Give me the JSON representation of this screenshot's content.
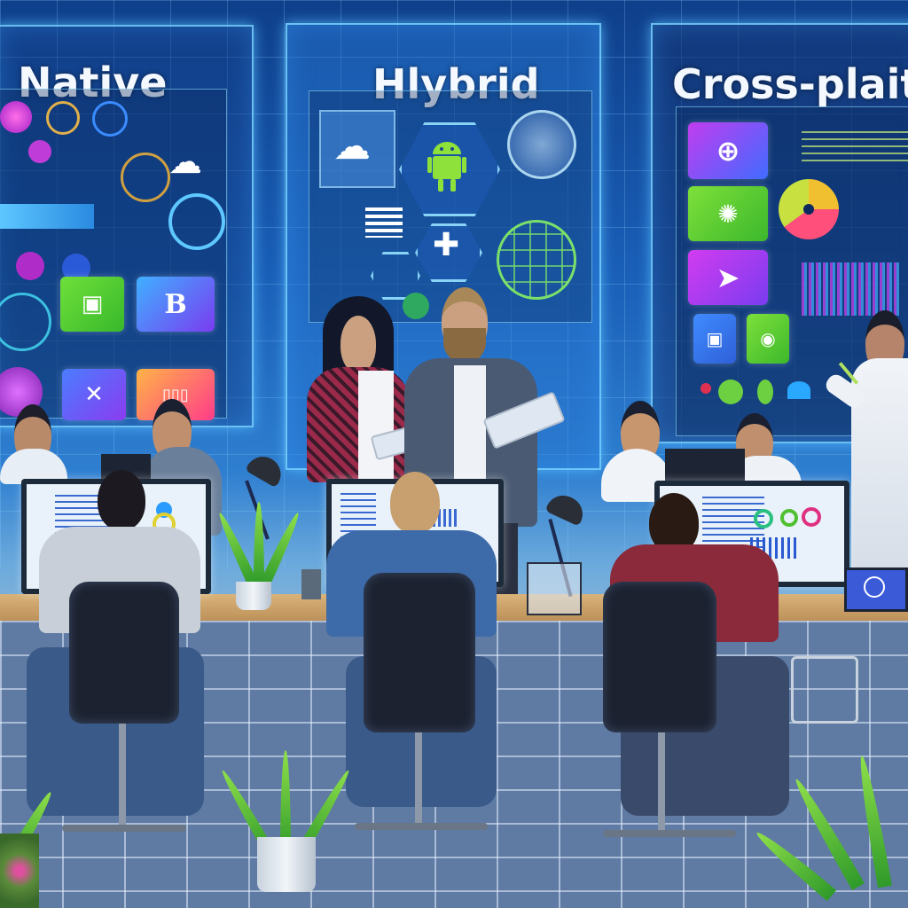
{
  "scene": {
    "description": "Illustration of a development team working in a futuristic office with holographic panels comparing app development approaches",
    "colors": {
      "wall_blue": "#1a5fb8",
      "panel_glow": "#78d2ff",
      "desk_wood": "#d9b37a",
      "floor_tile": "#5f7aa3"
    }
  },
  "panels": [
    {
      "title": "Native",
      "tiles": [
        {
          "icon": "bot-face-icon",
          "label": "",
          "color_from": "#6fe03a",
          "color_to": "#38b82c",
          "glyph": "▣"
        },
        {
          "icon": "letter-b-icon",
          "label": "",
          "color_from": "#3fb0ff",
          "color_to": "#7a3cf0",
          "glyph": "B"
        },
        {
          "icon": "cross-icon",
          "label": "",
          "color_from": "#4a7dff",
          "color_to": "#8a3cf0",
          "glyph": "✕"
        },
        {
          "icon": "bars-icon",
          "label": "",
          "color_from": "#ffb347",
          "color_to": "#ff3c8a",
          "glyph": "▯▯▯"
        }
      ],
      "decor_icons": [
        "cloud-icon",
        "spiral-icon",
        "orb-icon",
        "ring-icon"
      ]
    },
    {
      "title": "Hlybrid",
      "tiles": [
        {
          "icon": "android-icon",
          "label": "",
          "glyph": "🤖"
        },
        {
          "icon": "plus-icon",
          "label": "",
          "glyph": "✚"
        },
        {
          "icon": "globe-icon",
          "label": "",
          "glyph": "◍"
        },
        {
          "icon": "cloud-icon",
          "label": "",
          "glyph": "☁"
        }
      ]
    },
    {
      "title": "Cross-plaitl",
      "tiles": [
        {
          "icon": "globe-icon",
          "label": "",
          "color_from": "#c23cf0",
          "color_to": "#3f6cff",
          "glyph": "⊕"
        },
        {
          "icon": "gear-icon",
          "label": "",
          "color_from": "#7ee03a",
          "color_to": "#3cb82c",
          "glyph": "✺"
        },
        {
          "icon": "play-icon",
          "label": "",
          "color_from": "#d23cf0",
          "color_to": "#7a3cf0",
          "glyph": "➤"
        },
        {
          "icon": "image-icon",
          "label": "",
          "color_from": "#3f8cff",
          "color_to": "#2f5fd8",
          "glyph": "▣"
        },
        {
          "icon": "circle-icon",
          "label": "",
          "color_from": "#7ee03a",
          "color_to": "#3cb82c",
          "glyph": "◉"
        }
      ],
      "decor_icons": [
        "pie-chart-icon",
        "audio-waveform-icon",
        "dots-icon"
      ]
    }
  ],
  "people": [
    {
      "role": "developer-seated-left",
      "shirt": "#c9cfd8"
    },
    {
      "role": "developer-seated-center",
      "shirt": "#3d6aa8"
    },
    {
      "role": "developer-seated-right",
      "shirt": "#8a2a3a"
    },
    {
      "role": "standing-woman-tablet",
      "shirt": "#9b2a4a"
    },
    {
      "role": "standing-man-tablet",
      "shirt": "#4a5a72"
    },
    {
      "role": "presenter-right",
      "shirt": "#eef2f7"
    }
  ]
}
